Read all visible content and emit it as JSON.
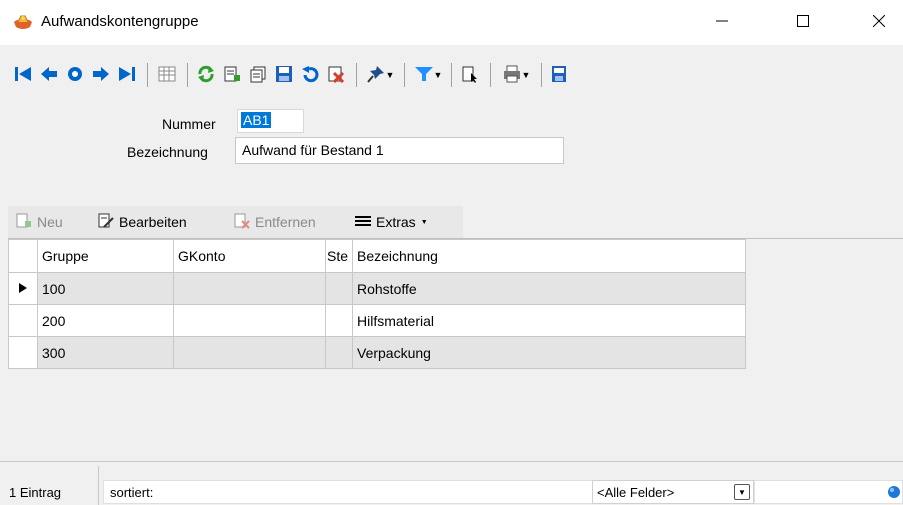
{
  "window": {
    "title": "Aufwandskontengruppe",
    "app_icon": "hands-money-icon",
    "controls": [
      "minimize-icon",
      "maximize-icon",
      "close-icon"
    ]
  },
  "toolbar": {
    "icons": [
      "first-record-icon",
      "previous-record-icon",
      "search-record-icon",
      "next-record-icon",
      "last-record-icon",
      "table-view-icon",
      "refresh-icon",
      "new-record-icon",
      "copy-record-icon",
      "save-icon",
      "undo-icon",
      "delete-icon",
      "pin-icon",
      "filter-icon",
      "document-info-icon",
      "print-icon",
      "save-layout-icon"
    ]
  },
  "form": {
    "nummer_label": "Nummer",
    "nummer_value": "AB1",
    "bezeichnung_label": "Bezeichnung",
    "bezeichnung_value": "Aufwand für Bestand 1"
  },
  "subtoolbar": {
    "neu": "Neu",
    "bearbeiten": "Bearbeiten",
    "entfernen": "Entfernen",
    "extras": "Extras"
  },
  "grid": {
    "columns": [
      "Gruppe",
      "GKonto",
      "Ste",
      "Bezeichnung"
    ],
    "rows": [
      {
        "gruppe": "100",
        "gkonto": "",
        "ste": "",
        "bezeichnung": "Rohstoffe"
      },
      {
        "gruppe": "200",
        "gkonto": "",
        "ste": "",
        "bezeichnung": "Hilfsmaterial"
      },
      {
        "gruppe": "300",
        "gkonto": "",
        "ste": "",
        "bezeichnung": "Verpackung"
      }
    ],
    "current_row": 0
  },
  "status": {
    "count": "1 Eintrag",
    "sort_label": "sortiert:",
    "field_select": "<Alle Felder>"
  },
  "colors": {
    "nav_blue": "#0066cc",
    "refresh_green": "#2e9e2e",
    "delete_red": "#d83b2b",
    "filter_blue": "#1e90ff",
    "selection_blue": "#0078d7"
  }
}
